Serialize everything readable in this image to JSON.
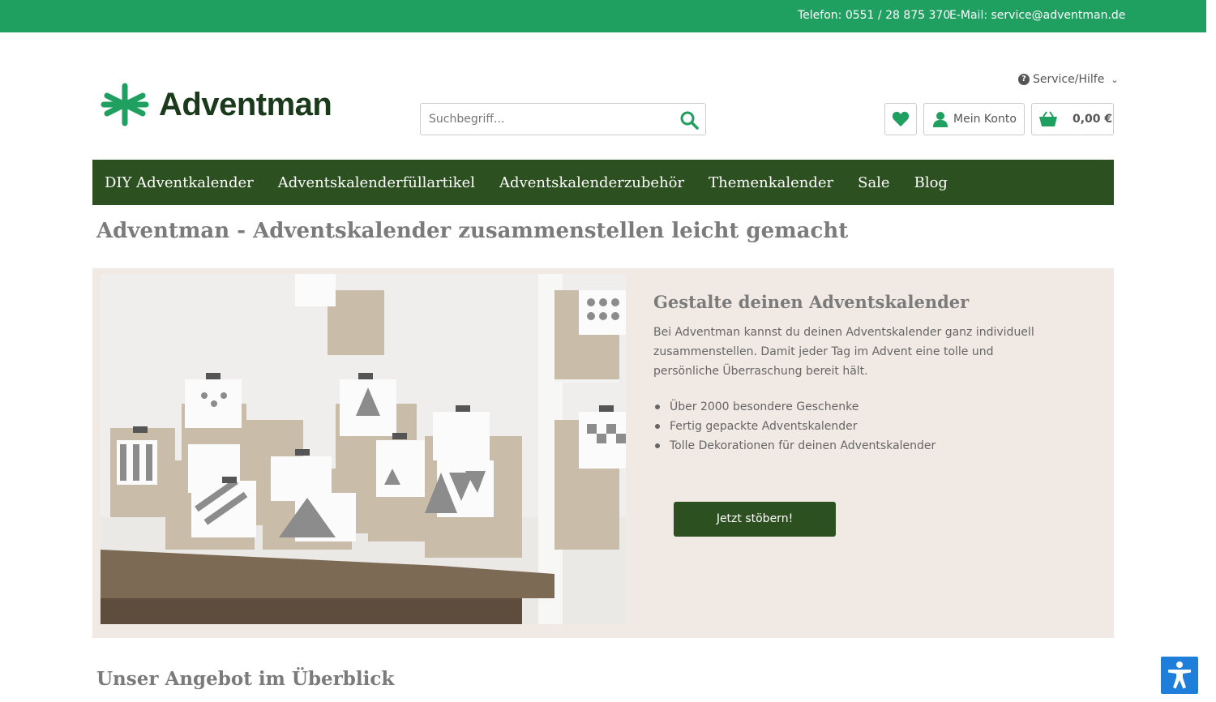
{
  "topbar": {
    "phone": "Telefon: 0551 / 28 875 370",
    "email": "E-Mail: service@adventman.de"
  },
  "header": {
    "brand": "Adventman",
    "service_label": "Service/Hilfe",
    "search_placeholder": "Suchbegriff...",
    "account_label": "Mein Konto",
    "cart_amount": "0,00 €"
  },
  "nav": {
    "items": [
      {
        "label": "DIY Adventkalender"
      },
      {
        "label": "Adventskalenderfüllartikel"
      },
      {
        "label": "Adventskalenderzubehör"
      },
      {
        "label": "Themenkalender"
      },
      {
        "label": "Sale"
      },
      {
        "label": "Blog"
      }
    ]
  },
  "main": {
    "page_title": "Adventman - Adventskalender zusammenstellen leicht gemacht",
    "hero": {
      "title": "Gestalte deinen Adventskalender",
      "text": "Bei Adventman kannst du deinen Adventskalender ganz individuell zusammenstellen. Damit jeder Tag im Advent eine tolle und persönliche Überraschung bereit hält.",
      "bullets": [
        "Über 2000 besondere Geschenke",
        "Fertig gepackte Adventskalender",
        "Tolle Dekorationen für deinen Adventskalender"
      ],
      "cta": "Jetzt stöbern!"
    },
    "section_title": "Unser Angebot im Überblick"
  },
  "colors": {
    "topbar": "#1fa061",
    "nav": "#2c5020",
    "hero_bg": "#f1e9e3",
    "accent": "#1fa061",
    "a11y": "#1f7ed9"
  },
  "icons": {
    "logo": "asterisk-logo-icon",
    "service": "question-circle-icon",
    "search": "magnifier-icon",
    "wishlist": "heart-icon",
    "account": "user-icon",
    "cart": "basket-icon",
    "accessibility": "accessibility-person-icon"
  }
}
